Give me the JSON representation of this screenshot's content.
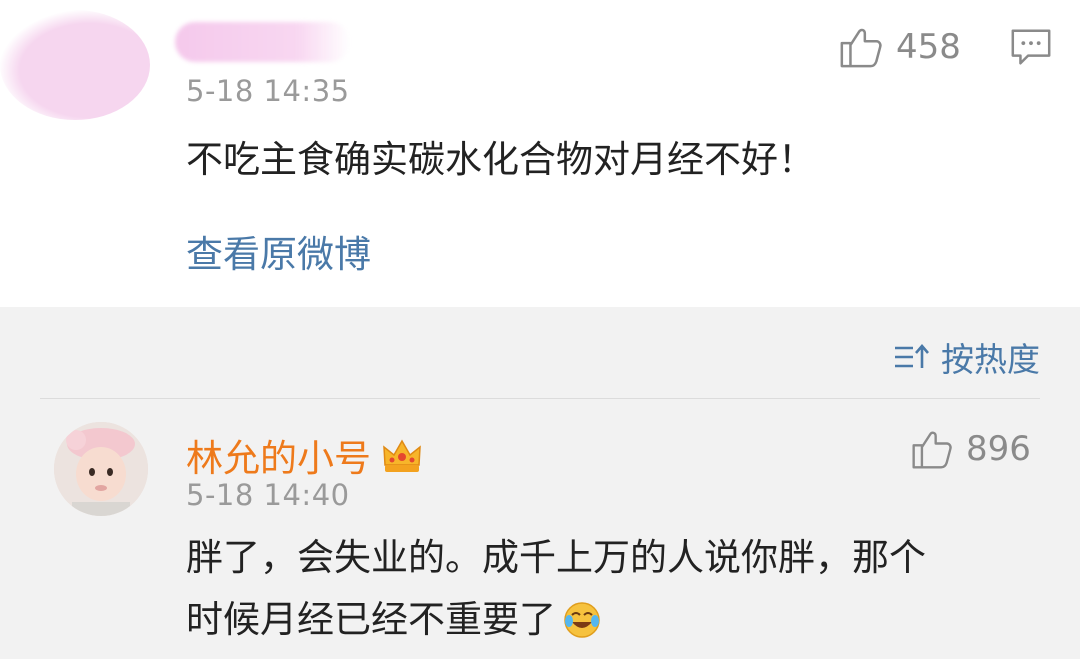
{
  "first_comment": {
    "time": "5-18 14:35",
    "likes": "458",
    "text": "不吃主食确实碳水化合物对月经不好！",
    "link": "查看原微博"
  },
  "sort": {
    "label": "按热度"
  },
  "second_comment": {
    "username": "林允的小号",
    "time": "5-18 14:40",
    "likes": "896",
    "text_line1": "胖了，会失业的。成千上万的人说你胖，那个",
    "text_line2": "时候月经已经不重要了"
  },
  "colors": {
    "username": "#ee7a1b",
    "link": "#4a79a8",
    "meta": "#9a9a9a"
  },
  "icons": [
    "thumb-up-icon",
    "comment-icon",
    "sort-icon",
    "crown-badge-icon",
    "laugh-cry-emoji-icon"
  ]
}
